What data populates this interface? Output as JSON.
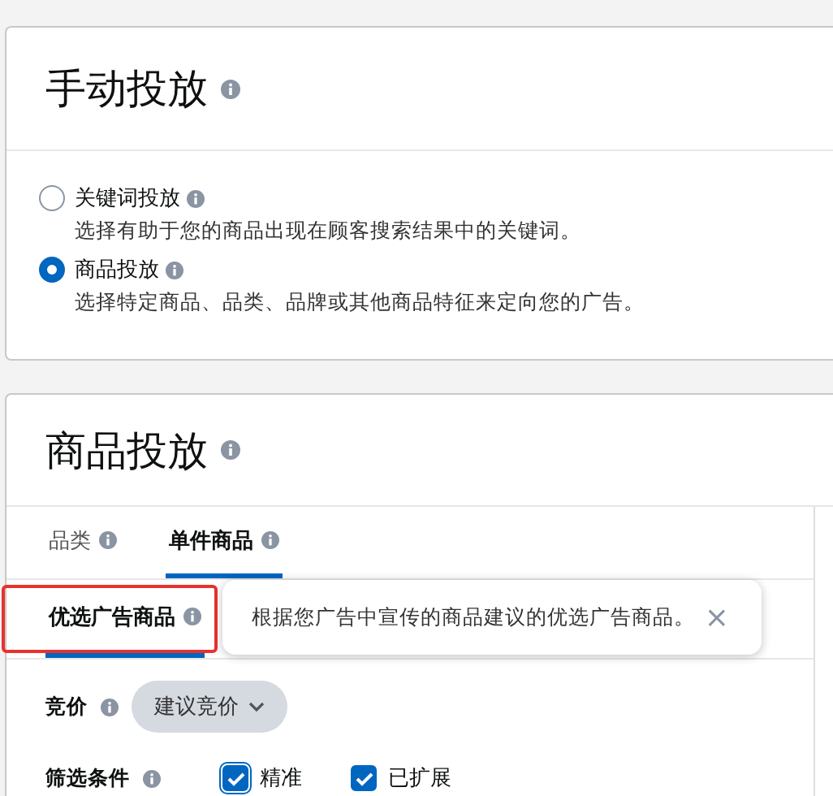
{
  "manual_section": {
    "title": "手动投放",
    "options": [
      {
        "label": "关键词投放",
        "description": "选择有助于您的商品出现在顾客搜索结果中的关键词。",
        "selected": false
      },
      {
        "label": "商品投放",
        "description": "选择特定商品、品类、品牌或其他商品特征来定向您的广告。",
        "selected": true
      }
    ]
  },
  "product_section": {
    "title": "商品投放",
    "tabs": [
      {
        "label": "品类",
        "selected": false
      },
      {
        "label": "单件商品",
        "selected": true
      }
    ],
    "subtabs": [
      {
        "label": "优选广告商品",
        "selected": true,
        "highlighted": true
      }
    ],
    "tooltip": {
      "text": "根据您广告中宣传的商品建议的优选广告商品。",
      "close": "×"
    },
    "bid": {
      "label": "竞价",
      "value": "建议竞价"
    },
    "filters": {
      "label": "筛选条件",
      "options": [
        {
          "label": "精准",
          "checked": true,
          "focused": true
        },
        {
          "label": "已扩展",
          "checked": true,
          "focused": false
        }
      ]
    }
  }
}
